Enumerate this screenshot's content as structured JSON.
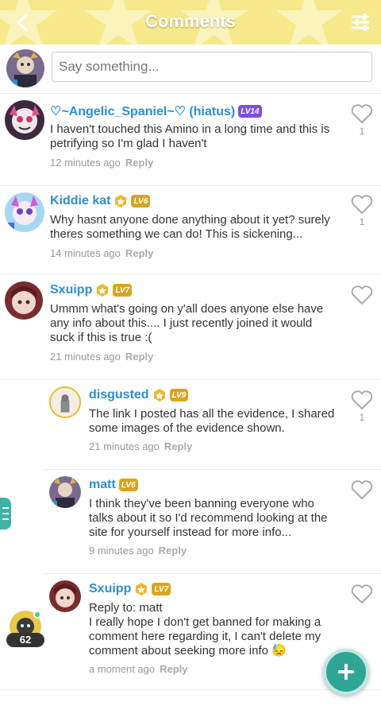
{
  "header": {
    "title": "Comments",
    "back_icon": "chevron-left-icon",
    "filter_icon": "sliders-icon",
    "background": "#f7e88c"
  },
  "composer": {
    "placeholder": "Say something..."
  },
  "comments": [
    {
      "author": "♡~Angelic_Spaniel~♡ (hiatus)",
      "level": "LV14",
      "gold": false,
      "text": "I haven't touched this Amino in a long time and this is petrifying so I'm glad I haven't",
      "time": "12 minutes ago",
      "reply": "Reply",
      "likes": "1"
    },
    {
      "author": "Kiddie kat",
      "level": "LV6",
      "gold": true,
      "text": "Why hasnt anyone done anything about it yet? surely theres something we can do! This is sickening...",
      "time": "14 minutes ago",
      "reply": "Reply",
      "likes": "1"
    },
    {
      "author": "Sxuipp",
      "level": "LV7",
      "gold": true,
      "text": "Ummm what's going on y'all does anyone else have any info about this.... I just recently joined it would suck if this is true :(",
      "time": "21 minutes ago",
      "reply": "Reply",
      "likes": ""
    },
    {
      "author": "disgusted",
      "level": "LV9",
      "gold": true,
      "text": "The link I posted has all the evidence, I shared some images of the evidence shown.",
      "time": "21 minutes ago",
      "reply": "Reply",
      "likes": "1"
    },
    {
      "author": "matt",
      "level": "LV6",
      "gold": false,
      "text": "I think they've been banning everyone who talks about it so I'd recommend looking at the site for yourself instead for more info...",
      "time": "9 minutes ago",
      "reply": "Reply",
      "likes": ""
    },
    {
      "author": "Sxuipp",
      "level": "LV7",
      "gold": true,
      "reply_to": "Reply to: matt",
      "text": "I really hope I don't get banned for making a comment here regarding it, I can't delete my comment about seeking more info 😓",
      "time": "a moment ago",
      "reply": "Reply",
      "likes": ""
    }
  ],
  "online_count": "62",
  "fab_icon": "plus-icon",
  "accent": "#2fa595",
  "link_color": "#2a8fd6"
}
